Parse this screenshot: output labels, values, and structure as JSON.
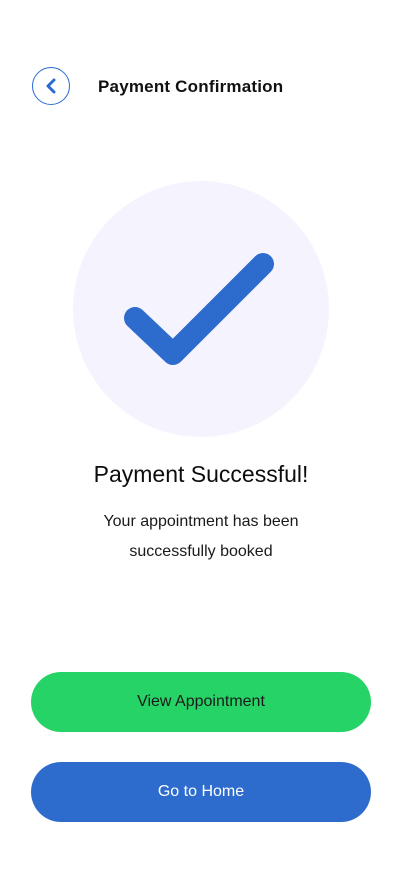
{
  "header": {
    "title": "Payment Confirmation",
    "back_icon": "chevron-left-icon"
  },
  "status": {
    "icon": "checkmark-icon",
    "headline": "Payment Successful!",
    "message": "Your appointment has been successfully booked"
  },
  "actions": {
    "view_label": "View Appointment",
    "home_label": "Go to Home"
  },
  "colors": {
    "primary_blue": "#2d6ccd",
    "success_green": "#25d366",
    "circle_bg": "#f5f4fe"
  }
}
